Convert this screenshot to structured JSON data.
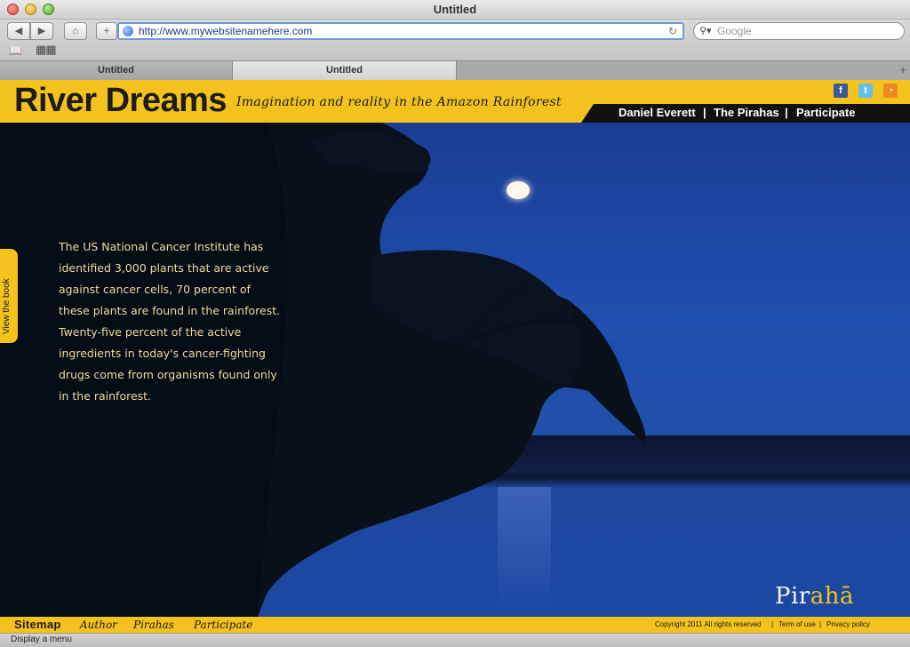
{
  "window": {
    "title": "Untitled"
  },
  "toolbar": {
    "back_icon": "back-arrow-icon",
    "forward_icon": "forward-arrow-icon",
    "home_icon": "home-icon",
    "add_icon": "plus-icon",
    "url": "http://www.mywebsitenamehere.com",
    "search_placeholder": "Google",
    "bookmarks_icon": "open-book-icon",
    "topsites_icon": "grid-icon"
  },
  "tabs": [
    {
      "label": "Untitled",
      "active": false
    },
    {
      "label": "Untitled",
      "active": true
    }
  ],
  "site": {
    "logo": "River Dreams",
    "tagline": "Imagination and reality in the Amazon Rainforest",
    "nav": [
      {
        "label": "Daniel Everett"
      },
      {
        "label": "The Pirahas"
      },
      {
        "label": "Participate"
      }
    ],
    "nav_separator": "|",
    "social": [
      {
        "icon": "facebook-icon",
        "glyph": "f",
        "color": "#3b5a9a"
      },
      {
        "icon": "twitter-icon",
        "glyph": "t",
        "color": "#5ec0ea"
      },
      {
        "icon": "rss-icon",
        "glyph": "◔",
        "color": "#f08a1c"
      }
    ],
    "side_tab": "View the book",
    "body_text": "The US National Cancer Institute has identified 3,000 plants that are active against cancer cells, 70 percent of these plants are found in the rainforest. Twenty-five percent of the active ingredients in today's cancer-fighting drugs come from organisms found only in the rainforest.",
    "brand_mark": {
      "prefix": "Pir",
      "highlight": "ahā"
    },
    "footer": {
      "sitemap": "Sitemap",
      "links": [
        "Author",
        "Pirahas",
        "Participate"
      ],
      "copyright": "Copyright 2011 All rights reserved",
      "terms": "Term of use",
      "privacy": "Privacy policy",
      "separator": "|"
    }
  },
  "status": {
    "text": "Display a menu"
  },
  "colors": {
    "accent_yellow": "#f4c21c",
    "nav_black": "#111111",
    "sky_blue": "#1f4fb0"
  }
}
